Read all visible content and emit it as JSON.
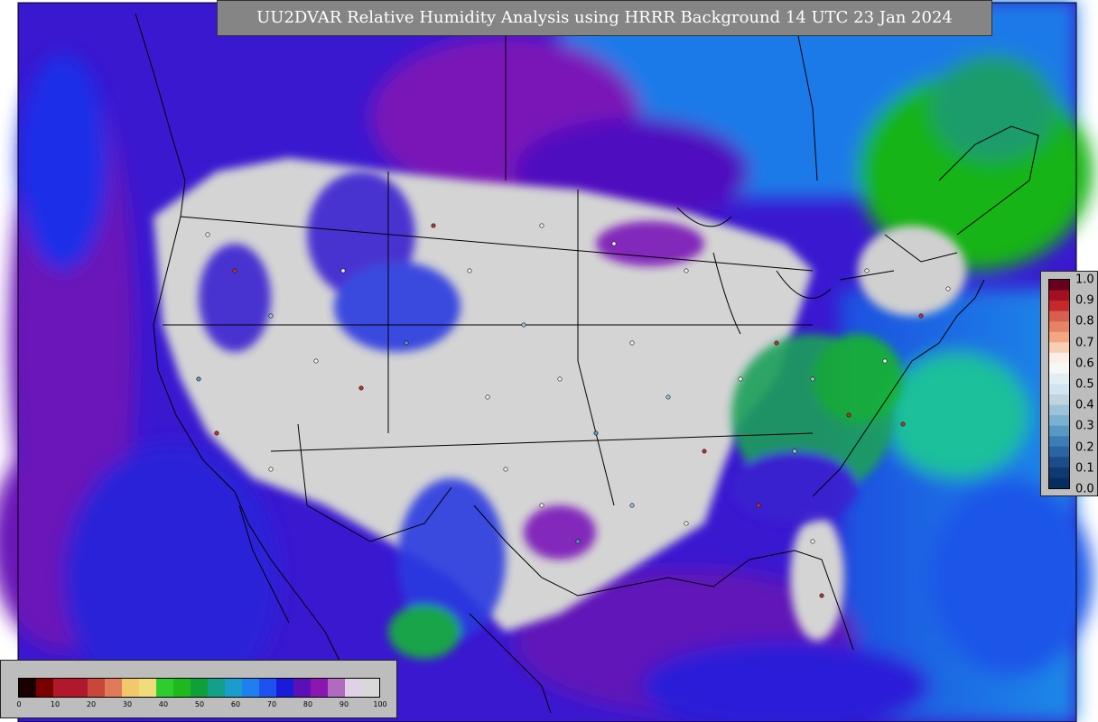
{
  "title": "UU2DVAR Relative Humidity Analysis using HRRR Background 14 UTC 23 Jan 2024",
  "observation_scale": {
    "labels": [
      "1.0",
      "0.9",
      "0.8",
      "0.7",
      "0.6",
      "0.5",
      "0.4",
      "0.3",
      "0.2",
      "0.1",
      "0.0"
    ],
    "colors": [
      "#67001f",
      "#a50f22",
      "#c6292c",
      "#d6604d",
      "#e58267",
      "#f4a582",
      "#f9cfb4",
      "#fbeee6",
      "#f7f7f7",
      "#e3eef3",
      "#d1e5f0",
      "#c0d4df",
      "#9ec2d8",
      "#7ab0d0",
      "#5a98c4",
      "#3c7db6",
      "#2a64a2",
      "#1c4d8a",
      "#0d3a73",
      "#062d5f"
    ]
  },
  "analysis_scale": {
    "labels": [
      "0",
      "10",
      "20",
      "30",
      "40",
      "50",
      "60",
      "70",
      "80",
      "90",
      "100"
    ],
    "colors": [
      "#1a0000",
      "#7a0000",
      "#b2182b",
      "#b2182b",
      "#c8473a",
      "#e07a5a",
      "#f2c96a",
      "#f0dc7a",
      "#2ecc2e",
      "#1fb81f",
      "#0fa03a",
      "#12a08a",
      "#1a9ccc",
      "#1e7ff0",
      "#1e52f0",
      "#1a1adc",
      "#5a10b4",
      "#8a18b0",
      "#b06ac0",
      "#e0d0e8",
      "#d8d8d8"
    ]
  }
}
